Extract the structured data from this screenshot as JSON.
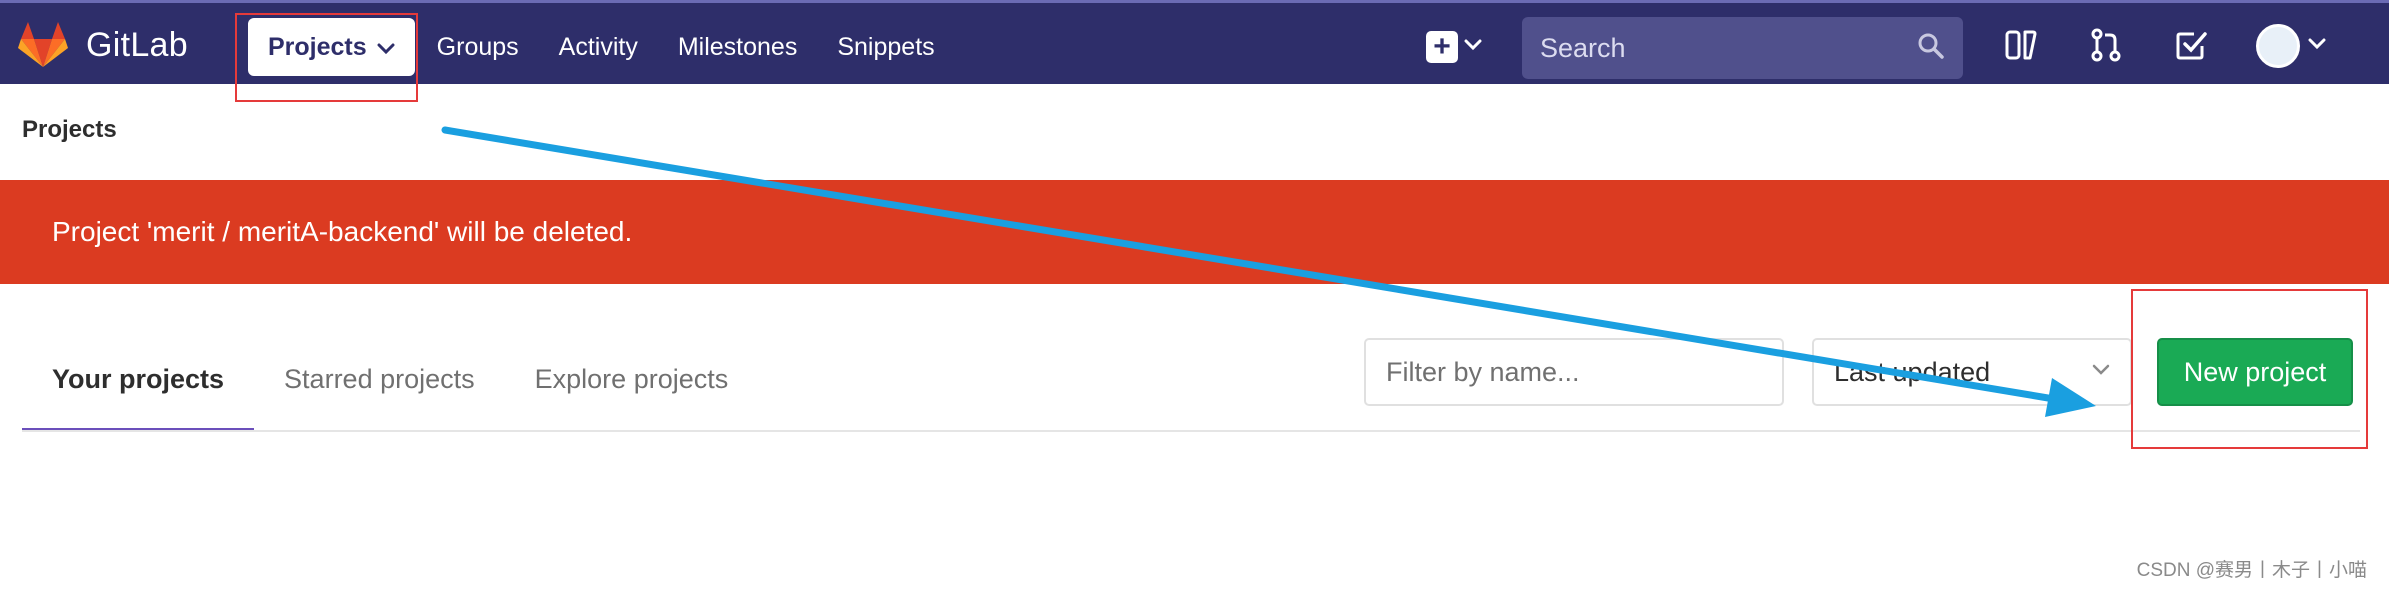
{
  "app": {
    "brand_name": "GitLab"
  },
  "nav": {
    "items": [
      {
        "label": "Projects"
      },
      {
        "label": "Groups"
      },
      {
        "label": "Activity"
      },
      {
        "label": "Milestones"
      },
      {
        "label": "Snippets"
      }
    ]
  },
  "search": {
    "placeholder": "Search"
  },
  "page": {
    "title": "Projects"
  },
  "flash": {
    "message": "Project 'merit / meritA-backend' will be deleted."
  },
  "tabs": [
    {
      "label": "Your projects",
      "active": true
    },
    {
      "label": "Starred projects",
      "active": false
    },
    {
      "label": "Explore projects",
      "active": false
    }
  ],
  "filter": {
    "placeholder": "Filter by name..."
  },
  "sort": {
    "selected": "Last updated"
  },
  "actions": {
    "new_project_label": "New project"
  },
  "watermark": "CSDN @赛男丨木子丨小喵",
  "colors": {
    "navbar": "#2e2e6a",
    "flash": "#db3b21",
    "primary_button": "#1aaa55",
    "active_tab_underline": "#6b4fbb",
    "annotation_box": "#e53a3a",
    "annotation_arrow": "#1a9fe0"
  },
  "icons": {
    "brand": "gitlab-tanuki-icon",
    "new_item": "plus-square-icon",
    "search": "search-icon",
    "todos_panel": "panel-icon",
    "merge_requests": "merge-request-icon",
    "todos": "check-square-icon",
    "user_menu": "avatar"
  }
}
